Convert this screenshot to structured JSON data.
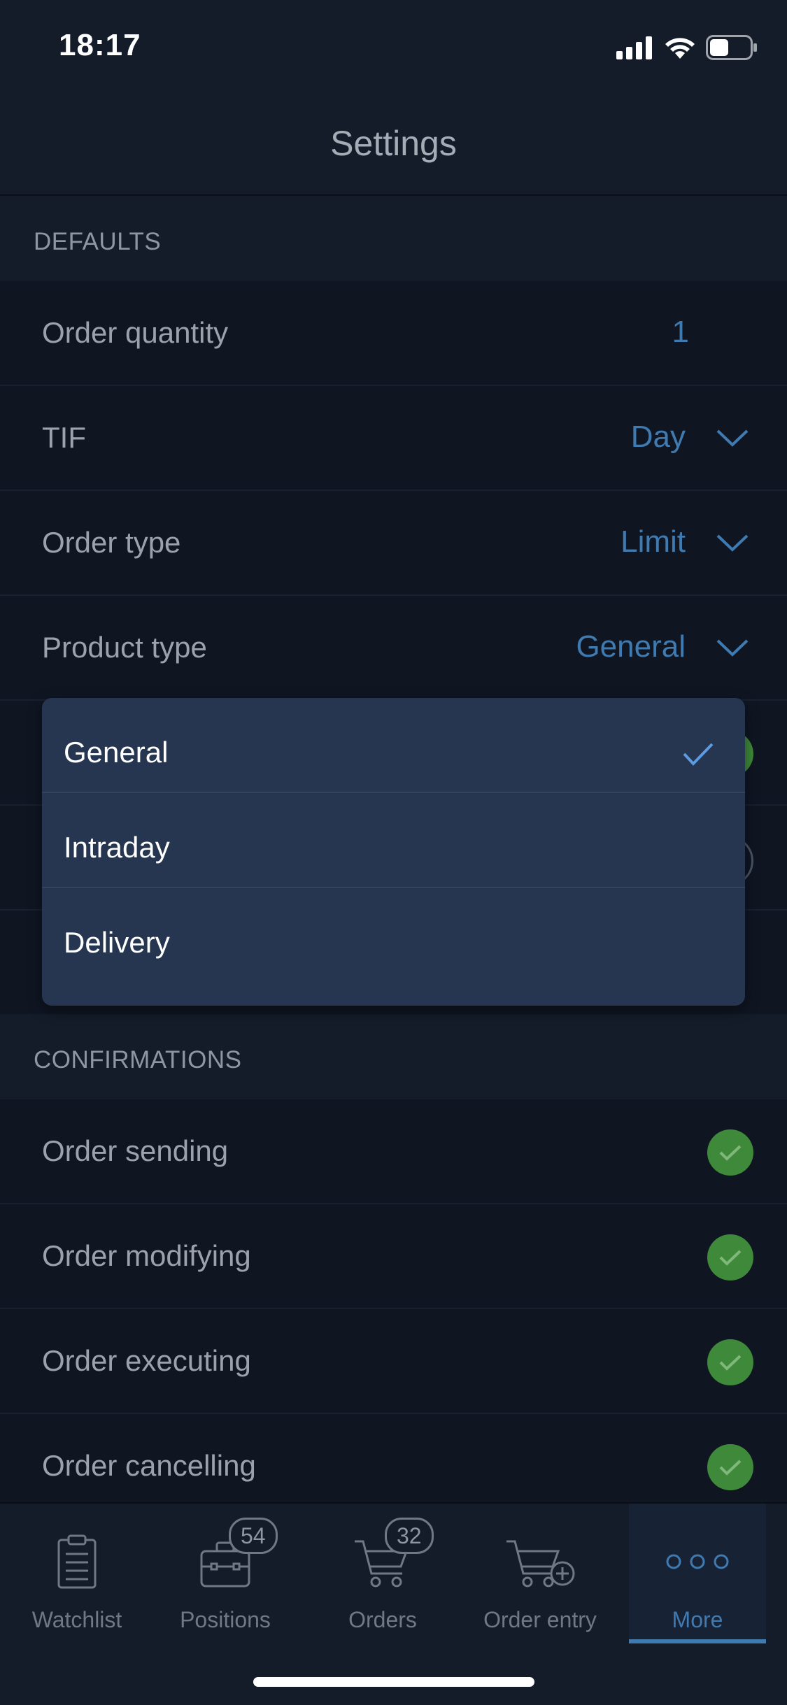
{
  "status": {
    "time": "18:17"
  },
  "nav": {
    "title": "Settings"
  },
  "defaults": {
    "header": "DEFAULTS",
    "order_quantity": {
      "label": "Order quantity",
      "value": "1"
    },
    "tif": {
      "label": "TIF",
      "value": "Day"
    },
    "order_type": {
      "label": "Order type",
      "value": "Limit"
    },
    "product_type": {
      "label": "Product type",
      "value": "General"
    }
  },
  "product_type_dropdown": {
    "options": [
      "General",
      "Intraday",
      "Delivery"
    ],
    "selected": "General"
  },
  "confirmations": {
    "header": "CONFIRMATIONS",
    "items": [
      {
        "label": "Order sending",
        "checked": true
      },
      {
        "label": "Order modifying",
        "checked": true
      },
      {
        "label": "Order executing",
        "checked": true
      },
      {
        "label": "Order cancelling",
        "checked": true
      }
    ]
  },
  "tabbar": {
    "tabs": [
      {
        "label": "Watchlist",
        "icon": "clipboard-icon"
      },
      {
        "label": "Positions",
        "icon": "briefcase-icon",
        "badge": "54"
      },
      {
        "label": "Orders",
        "icon": "cart-icon",
        "badge": "32"
      },
      {
        "label": "Order entry",
        "icon": "cart-add-icon"
      },
      {
        "label": "More",
        "icon": "more-icon",
        "active": true
      }
    ]
  },
  "colors": {
    "accent": "#3f7ab0",
    "check_green": "#3f8a3a",
    "dropdown_bg": "#263550",
    "background": "#0f1622"
  }
}
